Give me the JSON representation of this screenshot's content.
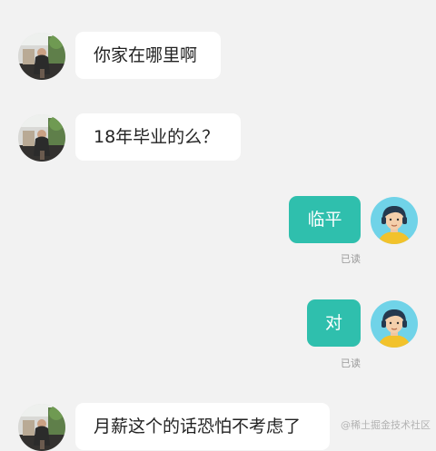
{
  "messages": [
    {
      "direction": "incoming",
      "text": "你家在哪里啊"
    },
    {
      "direction": "incoming",
      "text": "18年毕业的么？"
    },
    {
      "direction": "outgoing",
      "text": "临平",
      "status": "已读"
    },
    {
      "direction": "outgoing",
      "text": "对",
      "status": "已读"
    },
    {
      "direction": "incoming",
      "text": "月薪这个的话恐怕不考虑了"
    }
  ],
  "watermark": "@稀土掘金技术社区",
  "colors": {
    "background": "#f2f2f2",
    "incoming_bubble": "#ffffff",
    "outgoing_bubble": "#2fbfad",
    "read_status": "#9a9a9a"
  },
  "icons": {
    "incoming_avatar": "photo-avatar",
    "outgoing_avatar": "cartoon-man-avatar"
  }
}
